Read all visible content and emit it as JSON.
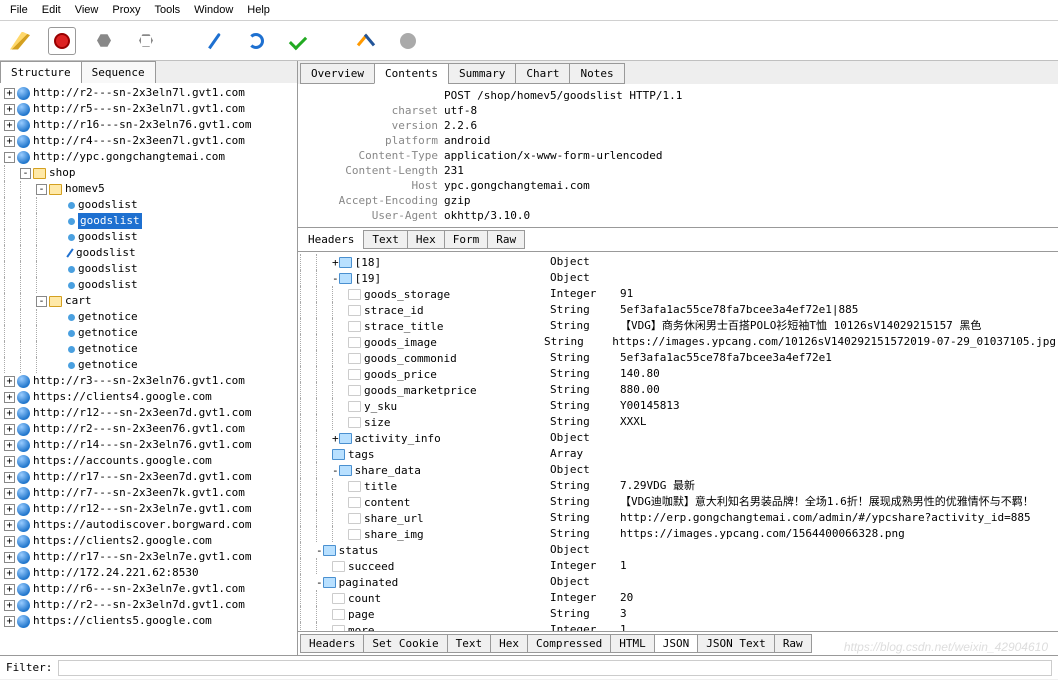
{
  "menu": [
    "File",
    "Edit",
    "View",
    "Proxy",
    "Tools",
    "Window",
    "Help"
  ],
  "left_tabs": [
    "Structure",
    "Sequence"
  ],
  "tree": {
    "hosts_top": [
      "http://r2---sn-2x3eln7l.gvt1.com",
      "http://r5---sn-2x3eln7l.gvt1.com",
      "http://r16---sn-2x3eln76.gvt1.com",
      "http://r4---sn-2x3een7l.gvt1.com"
    ],
    "ypc": "http://ypc.gongchangtemai.com",
    "shop": "shop",
    "homev5": "homev5",
    "goodslist": [
      "goodslist",
      "goodslist",
      "goodslist",
      "goodslist",
      "goodslist",
      "goodslist"
    ],
    "cart": "cart",
    "getnotice": [
      "getnotice",
      "getnotice",
      "getnotice",
      "getnotice"
    ],
    "hosts_bottom": [
      "http://r3---sn-2x3eln76.gvt1.com",
      "https://clients4.google.com",
      "http://r12---sn-2x3een7d.gvt1.com",
      "http://r2---sn-2x3een76.gvt1.com",
      "http://r14---sn-2x3eln76.gvt1.com",
      "https://accounts.google.com",
      "http://r17---sn-2x3een7d.gvt1.com",
      "http://r7---sn-2x3een7k.gvt1.com",
      "http://r12---sn-2x3eln7e.gvt1.com",
      "https://autodiscover.borgward.com",
      "https://clients2.google.com",
      "http://r17---sn-2x3eln7e.gvt1.com",
      "http://172.24.221.62:8530",
      "http://r6---sn-2x3eln7e.gvt1.com",
      "http://r2---sn-2x3eln7d.gvt1.com",
      "https://clients5.google.com"
    ]
  },
  "right_tabs": [
    "Overview",
    "Contents",
    "Summary",
    "Chart",
    "Notes"
  ],
  "request_line": "POST /shop/homev5/goodslist HTTP/1.1",
  "headers": [
    {
      "k": "charset",
      "v": "utf-8"
    },
    {
      "k": "version",
      "v": "2.2.6"
    },
    {
      "k": "platform",
      "v": "android"
    },
    {
      "k": "Content-Type",
      "v": "application/x-www-form-urlencoded"
    },
    {
      "k": "Content-Length",
      "v": "231"
    },
    {
      "k": "Host",
      "v": "ypc.gongchangtemai.com"
    },
    {
      "k": "Accept-Encoding",
      "v": "gzip"
    },
    {
      "k": "User-Agent",
      "v": "okhttp/3.10.0"
    }
  ],
  "sub_tabs_top": [
    "Headers",
    "Text",
    "Hex",
    "Form",
    "Raw"
  ],
  "json": [
    {
      "ind": 2,
      "exp": "+",
      "icon": "folder",
      "k": "[18]",
      "t": "Object",
      "v": ""
    },
    {
      "ind": 2,
      "exp": "-",
      "icon": "folder",
      "k": "[19]",
      "t": "Object",
      "v": ""
    },
    {
      "ind": 3,
      "exp": "",
      "icon": "leaf",
      "k": "goods_storage",
      "t": "Integer",
      "v": "91"
    },
    {
      "ind": 3,
      "exp": "",
      "icon": "leaf",
      "k": "strace_id",
      "t": "String",
      "v": "5ef3afa1ac55ce78fa7bcee3a4ef72e1|885"
    },
    {
      "ind": 3,
      "exp": "",
      "icon": "leaf",
      "k": "strace_title",
      "t": "String",
      "v": "【VDG】商务休闲男士百搭POLO衫短袖T恤 10126sV14029215157 黑色"
    },
    {
      "ind": 3,
      "exp": "",
      "icon": "leaf",
      "k": "goods_image",
      "t": "String",
      "v": "https://images.ypcang.com/10126sV140292151572019-07-29_01037105.jpg"
    },
    {
      "ind": 3,
      "exp": "",
      "icon": "leaf",
      "k": "goods_commonid",
      "t": "String",
      "v": "5ef3afa1ac55ce78fa7bcee3a4ef72e1"
    },
    {
      "ind": 3,
      "exp": "",
      "icon": "leaf",
      "k": "goods_price",
      "t": "String",
      "v": "140.80"
    },
    {
      "ind": 3,
      "exp": "",
      "icon": "leaf",
      "k": "goods_marketprice",
      "t": "String",
      "v": "880.00"
    },
    {
      "ind": 3,
      "exp": "",
      "icon": "leaf",
      "k": "y_sku",
      "t": "String",
      "v": "Y00145813"
    },
    {
      "ind": 3,
      "exp": "",
      "icon": "leaf",
      "k": "size",
      "t": "String",
      "v": "XXXL"
    },
    {
      "ind": 2,
      "exp": "+",
      "icon": "folder",
      "k": "activity_info",
      "t": "Object",
      "v": ""
    },
    {
      "ind": 2,
      "exp": "",
      "icon": "folder",
      "k": "tags",
      "t": "Array",
      "v": ""
    },
    {
      "ind": 2,
      "exp": "-",
      "icon": "folder",
      "k": "share_data",
      "t": "Object",
      "v": ""
    },
    {
      "ind": 3,
      "exp": "",
      "icon": "leaf",
      "k": "title",
      "t": "String",
      "v": "7.29VDG 最新"
    },
    {
      "ind": 3,
      "exp": "",
      "icon": "leaf",
      "k": "content",
      "t": "String",
      "v": "【VDG迪咖默】意大利知名男装品牌！全场1.6折！展现成熟男性的优雅情怀与不羁！"
    },
    {
      "ind": 3,
      "exp": "",
      "icon": "leaf",
      "k": "share_url",
      "t": "String",
      "v": "http://erp.gongchangtemai.com/admin/#/ypcshare?activity_id=885"
    },
    {
      "ind": 3,
      "exp": "",
      "icon": "leaf",
      "k": "share_img",
      "t": "String",
      "v": "https://images.ypcang.com/1564400066328.png"
    },
    {
      "ind": 1,
      "exp": "-",
      "icon": "folder",
      "k": "status",
      "t": "Object",
      "v": ""
    },
    {
      "ind": 2,
      "exp": "",
      "icon": "leaf",
      "k": "succeed",
      "t": "Integer",
      "v": "1"
    },
    {
      "ind": 1,
      "exp": "-",
      "icon": "folder",
      "k": "paginated",
      "t": "Object",
      "v": ""
    },
    {
      "ind": 2,
      "exp": "",
      "icon": "leaf",
      "k": "count",
      "t": "Integer",
      "v": "20"
    },
    {
      "ind": 2,
      "exp": "",
      "icon": "leaf",
      "k": "page",
      "t": "String",
      "v": "3"
    },
    {
      "ind": 2,
      "exp": "",
      "icon": "leaf",
      "k": "more",
      "t": "Integer",
      "v": "1"
    }
  ],
  "bottom_tabs": [
    "Headers",
    "Set Cookie",
    "Text",
    "Hex",
    "Compressed",
    "HTML",
    "JSON",
    "JSON Text",
    "Raw"
  ],
  "filter_label": "Filter:",
  "watermark": "https://blog.csdn.net/weixin_42904610"
}
